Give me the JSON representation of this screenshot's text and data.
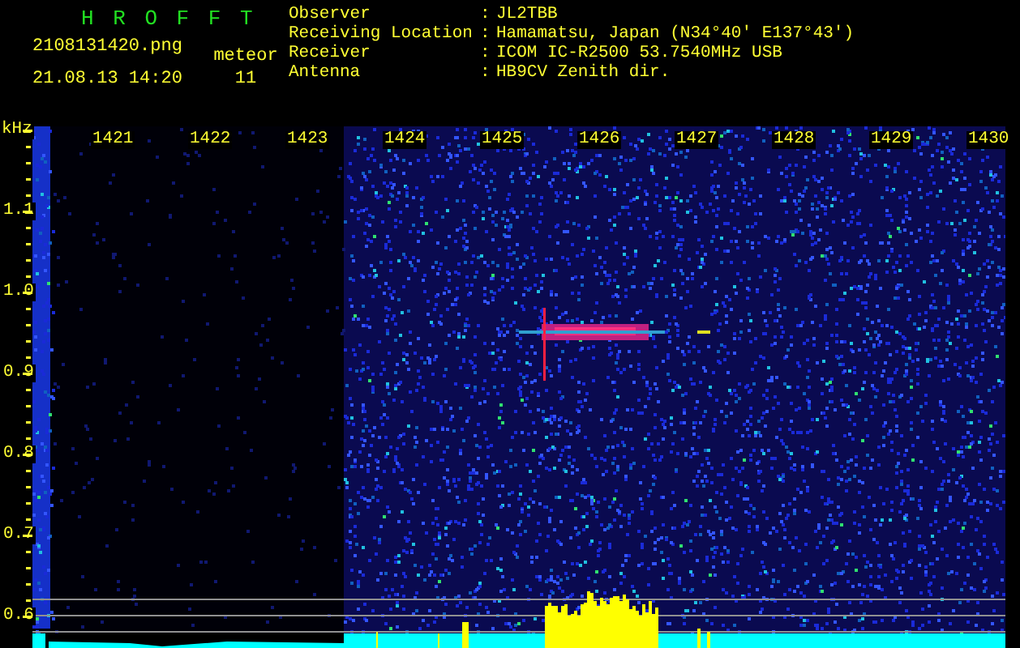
{
  "header": {
    "title": "H R O F F T",
    "filename": "2108131420.png",
    "timestamp": "21.08.13 14:20",
    "mode_label": "meteor",
    "count": "11"
  },
  "station": [
    {
      "label": "Observer",
      "value": "JL2TBB"
    },
    {
      "label": "Receiving Location",
      "value": "Hamamatsu, Japan (N34°40' E137°43')"
    },
    {
      "label": "Receiver",
      "value": "ICOM IC-R2500 53.7540MHz USB"
    },
    {
      "label": "Antenna",
      "value": "HB9CV Zenith dir."
    }
  ],
  "separator": ":",
  "spectrogram": {
    "unit": "kHz",
    "x_labels": [
      "1421",
      "1422",
      "1423",
      "1424",
      "1425",
      "1426",
      "1427",
      "1428",
      "1429",
      "1430"
    ],
    "y_labels": [
      "1.1",
      "1.0",
      "0.9",
      "0.8",
      "0.7",
      "0.6"
    ]
  }
}
